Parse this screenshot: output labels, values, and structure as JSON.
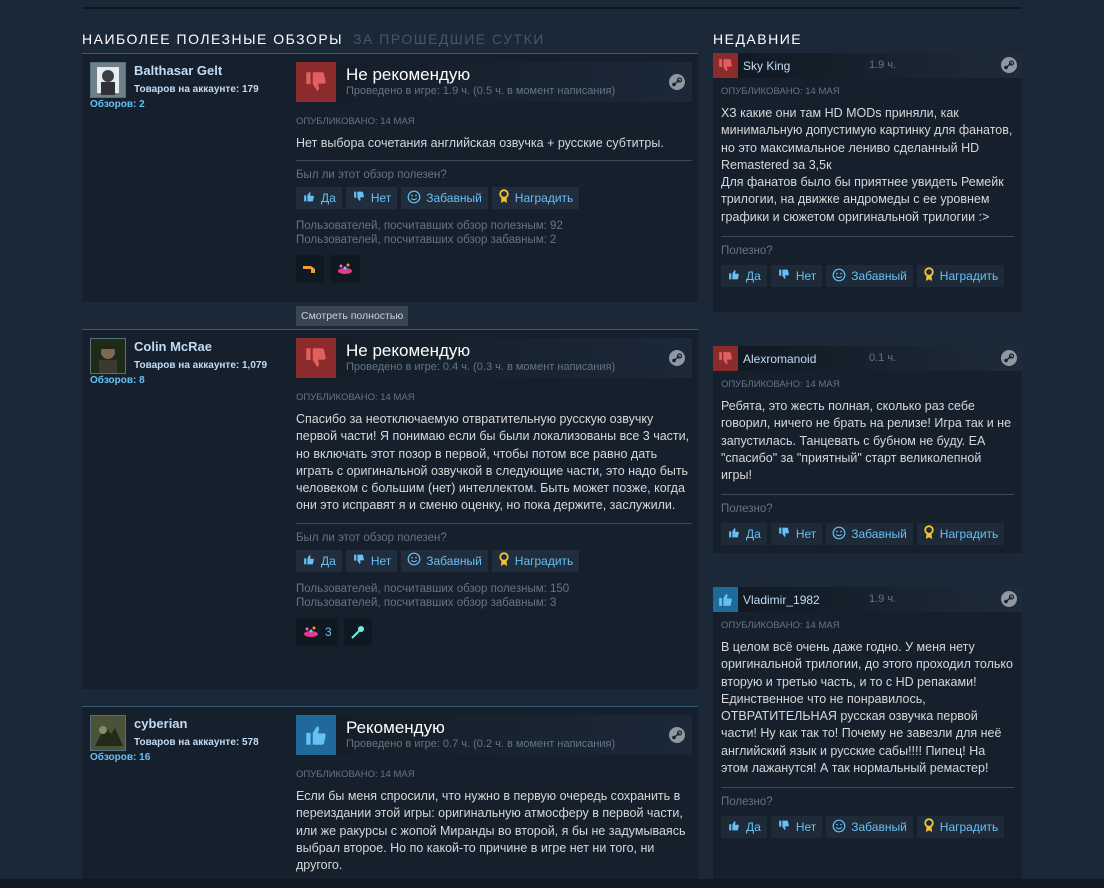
{
  "headers": {
    "helpful_title": "Наиболее полезные обзоры",
    "helpful_period": "за прошедшие сутки",
    "recent_title": "Недавние"
  },
  "labels": {
    "helpful_question": "Был ли этот обзор полезен?",
    "helpful_question_short": "Полезно?",
    "yes": "Да",
    "no": "Нет",
    "funny": "Забавный",
    "award": "Наградить",
    "read_more": "Смотреть полностью"
  },
  "colors": {
    "background": "#1b2838",
    "link": "#66c0f4",
    "negative": "#8b2b2b",
    "positive": "#1f6a9a"
  },
  "helpful_reviews": [
    {
      "author": "Balthasar Gelt",
      "products": "Товаров на аккаунте: 179",
      "reviews": "Обзоров: 2",
      "verdict": "Не рекомендую",
      "positive": false,
      "hours": "Проведено в игре: 1.9 ч. (0.5 ч. в момент написания)",
      "posted": "Опубликовано: 14 мая",
      "text": "Нет выбора сочетания английская озвучка + русские субтитры.",
      "helpful_count": "Пользователей, посчитавших обзор полезным: 92",
      "funny_count": "Пользователей, посчитавших обзор забавным: 2",
      "award_icons": [
        "tool-award-icon",
        "party-award-icon"
      ],
      "award_count": ""
    },
    {
      "author": "Colin McRae",
      "products": "Товаров на аккаунте: 1,079",
      "reviews": "Обзоров: 8",
      "verdict": "Не рекомендую",
      "positive": false,
      "hours": "Проведено в игре: 0.4 ч. (0.3 ч. в момент написания)",
      "posted": "Опубликовано: 14 мая",
      "text": "Спасибо за неотключаемую отвратительную русскую озвучку первой части! Я понимаю если бы были локализованы все 3 части, но включать этот позор в первой, чтобы потом все равно дать играть с оригинальной озвучкой в следующие части, это надо быть человеком с большим (нет) интеллектом. Быть может позже, когда они это исправят я и сменю оценку, но пока держите, заслужили.",
      "helpful_count": "Пользователей, посчитавших обзор полезным: 150",
      "funny_count": "Пользователей, посчитавших обзор забавным: 3",
      "award_icons": [
        "party-award-icon",
        "comet-award-icon"
      ],
      "award_count": "3"
    },
    {
      "author": "cyberian",
      "products": "Товаров на аккаунте: 578",
      "reviews": "Обзоров: 16",
      "verdict": "Рекомендую",
      "positive": true,
      "hours": "Проведено в игре: 0.7 ч. (0.2 ч. в момент написания)",
      "posted": "Опубликовано: 14 мая",
      "text": "Если бы меня спросили, что нужно в первую очередь сохранить в переиздании этой игры: оригинальную атмосферу в первой части, или же ракурсы с жопой Миранды во второй, я бы не задумываясь выбрал второе. Но по какой-то причине в игре нет ни того, ни другого."
    }
  ],
  "recent_reviews": [
    {
      "author": "Sky King",
      "hours": "1.9 ч.",
      "positive": false,
      "posted": "Опубликовано: 14 мая",
      "text": "ХЗ какие они там HD MODs приняли, как минимальную допустимую картинку для фанатов, но это максимальное лениво сделанный HD Remastered за 3,5к\nДля фанатов было бы приятнее увидеть Ремейк трилогии, на движке андромеды с ее уровнем графики и сюжетом оригинальной трилогии :>"
    },
    {
      "author": "Alexromanoid",
      "hours": "0.1 ч.",
      "positive": false,
      "posted": "Опубликовано: 14 мая",
      "text": "Ребята, это жесть полная, сколько раз себе говорил, ничего не брать на релизе! Игра так и не запустилась. Танцевать с бубном не буду. ЕА \"спасибо\" за \"приятный\" старт великолепной игры!"
    },
    {
      "author": "Vladimir_1982",
      "hours": "1.9 ч.",
      "positive": true,
      "posted": "Опубликовано: 14 мая",
      "text": "В целом всё очень даже годно. У меня нету оригинальной трилогии, до этого проходил только вторую и третью часть, и то с HD репаками! Единственное что не понравилось, ОТВРАТИТЕЛЬНАЯ русская озвучка первой части! Ну как так то! Почему не завезли для неё английский язык и русские сабы!!!! Пипец! На этом лажанутся! А так нормальный ремастер!"
    }
  ]
}
